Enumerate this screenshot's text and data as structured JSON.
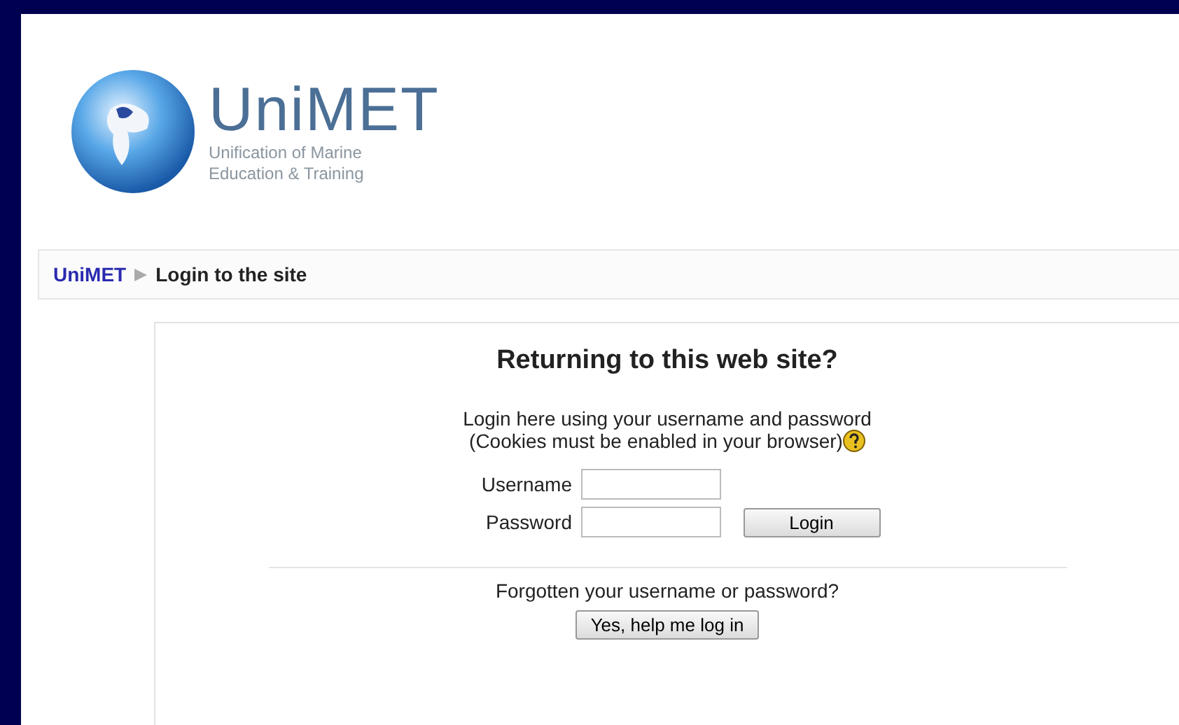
{
  "logo": {
    "name": "UniMET",
    "tagline_lines": [
      "Unification of Marine",
      "Education & Training"
    ]
  },
  "breadcrumb": {
    "items": [
      {
        "label": "UniMET",
        "kind": "link"
      },
      {
        "label": "Login to the site",
        "kind": "current"
      }
    ]
  },
  "login": {
    "heading": "Returning to this web site?",
    "intro_lines": [
      "Login here using your username and password",
      "(Cookies must be enabled in your browser)"
    ],
    "fields": [
      {
        "label": "Username"
      },
      {
        "label": "Password"
      }
    ],
    "login_button": "Login",
    "forgot_text": "Forgotten your username or password?",
    "help_button": "Yes, help me log in"
  }
}
